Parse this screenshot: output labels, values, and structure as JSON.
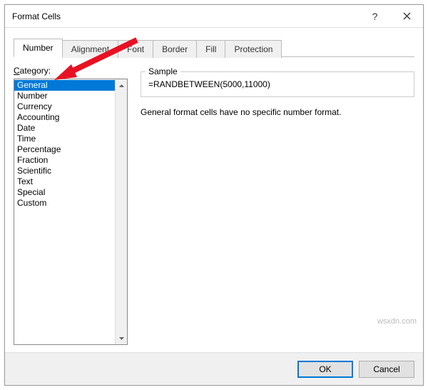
{
  "window": {
    "title": "Format Cells"
  },
  "tabs": {
    "t0": "Number",
    "t1": "Alignment",
    "t2": "Font",
    "t3": "Border",
    "t4": "Fill",
    "t5": "Protection"
  },
  "category": {
    "label_prefix": "C",
    "label_rest": "ategory:",
    "items": {
      "i0": "General",
      "i1": "Number",
      "i2": "Currency",
      "i3": "Accounting",
      "i4": "Date",
      "i5": "Time",
      "i6": "Percentage",
      "i7": "Fraction",
      "i8": "Scientific",
      "i9": "Text",
      "i10": "Special",
      "i11": "Custom"
    }
  },
  "sample": {
    "legend": "Sample",
    "value": "=RANDBETWEEN(5000,11000)"
  },
  "description": "General format cells have no specific number format.",
  "buttons": {
    "ok": "OK",
    "cancel": "Cancel"
  },
  "watermark": "wsxdn.com"
}
